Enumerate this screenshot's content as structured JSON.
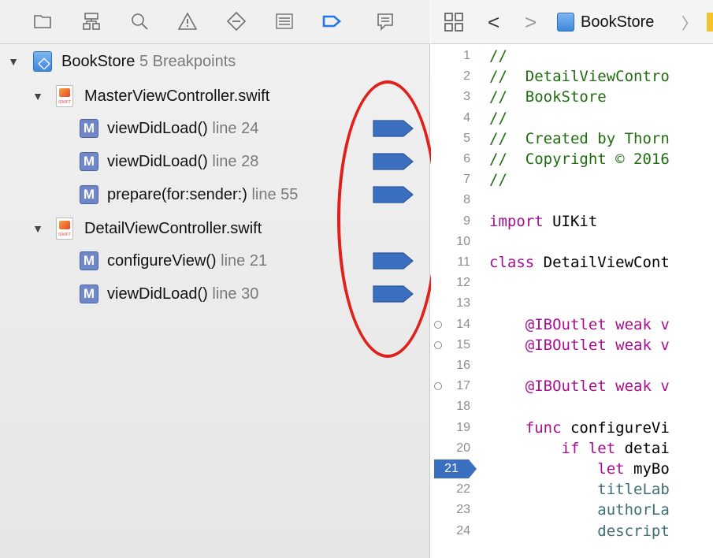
{
  "navigator": {
    "toolbar_icons": [
      "folder-icon",
      "hierarchy-icon",
      "search-icon",
      "warning-icon",
      "test-diamond-icon",
      "debug-list-icon",
      "breakpoint-icon",
      "report-bubble-icon"
    ],
    "project": {
      "name": "BookStore",
      "count": "5 Breakpoints"
    },
    "files": [
      {
        "name": "MasterViewController.swift",
        "breakpoints": [
          {
            "method": "viewDidLoad()",
            "line": "line 24"
          },
          {
            "method": "viewDidLoad()",
            "line": "line 28"
          },
          {
            "method": "prepare(for:sender:)",
            "line": "line 55"
          }
        ]
      },
      {
        "name": "DetailViewController.swift",
        "breakpoints": [
          {
            "method": "configureView()",
            "line": "line 21"
          },
          {
            "method": "viewDidLoad()",
            "line": "line 30"
          }
        ]
      }
    ],
    "method_badge": "M",
    "file_badge": "SWIFT"
  },
  "jump_bar": {
    "grid_icon": "grid-icon",
    "back": "<",
    "forward": ">",
    "project": "BookStore",
    "separator": "〉"
  },
  "editor": {
    "active_line": "21",
    "lines": [
      {
        "n": "1",
        "parts": [
          {
            "t": "//",
            "c": "comment"
          }
        ]
      },
      {
        "n": "2",
        "parts": [
          {
            "t": "//  DetailViewContro",
            "c": "comment"
          }
        ]
      },
      {
        "n": "3",
        "parts": [
          {
            "t": "//  BookStore",
            "c": "comment"
          }
        ]
      },
      {
        "n": "4",
        "parts": [
          {
            "t": "//",
            "c": "comment"
          }
        ]
      },
      {
        "n": "5",
        "parts": [
          {
            "t": "//  Created by Thorn",
            "c": "comment"
          }
        ]
      },
      {
        "n": "6",
        "parts": [
          {
            "t": "//  Copyright © 2016",
            "c": "comment"
          }
        ]
      },
      {
        "n": "7",
        "parts": [
          {
            "t": "//",
            "c": "comment"
          }
        ]
      },
      {
        "n": "8",
        "parts": []
      },
      {
        "n": "9",
        "parts": [
          {
            "t": "import",
            "c": "kw"
          },
          {
            "t": " UIKit",
            "c": "plain"
          }
        ]
      },
      {
        "n": "10",
        "parts": []
      },
      {
        "n": "11",
        "parts": [
          {
            "t": "class",
            "c": "kw"
          },
          {
            "t": " DetailViewCont",
            "c": "plain"
          }
        ]
      },
      {
        "n": "12",
        "parts": []
      },
      {
        "n": "13",
        "parts": []
      },
      {
        "n": "14",
        "outlet": true,
        "parts": [
          {
            "t": "    @IBOutlet weak v",
            "c": "kw"
          }
        ]
      },
      {
        "n": "15",
        "outlet": true,
        "parts": [
          {
            "t": "    @IBOutlet weak v",
            "c": "kw"
          }
        ]
      },
      {
        "n": "16",
        "parts": []
      },
      {
        "n": "17",
        "outlet": true,
        "parts": [
          {
            "t": "    @IBOutlet weak v",
            "c": "kw"
          }
        ]
      },
      {
        "n": "18",
        "parts": []
      },
      {
        "n": "19",
        "parts": [
          {
            "t": "    func",
            "c": "kw"
          },
          {
            "t": " configureVi",
            "c": "plain"
          }
        ]
      },
      {
        "n": "20",
        "parts": [
          {
            "t": "        if let",
            "c": "kw"
          },
          {
            "t": " detai",
            "c": "plain"
          }
        ]
      },
      {
        "n": "21",
        "parts": [
          {
            "t": "            let",
            "c": "kw"
          },
          {
            "t": " myBo",
            "c": "plain"
          }
        ]
      },
      {
        "n": "22",
        "parts": [
          {
            "t": "            titleLab",
            "c": "teal"
          }
        ]
      },
      {
        "n": "23",
        "parts": [
          {
            "t": "            authorLa",
            "c": "teal"
          }
        ]
      },
      {
        "n": "24",
        "parts": [
          {
            "t": "            descript",
            "c": "teal"
          }
        ]
      }
    ]
  },
  "colors": {
    "breakpoint_blue": "#3b6fc0",
    "annotation_red": "#e0201b"
  }
}
